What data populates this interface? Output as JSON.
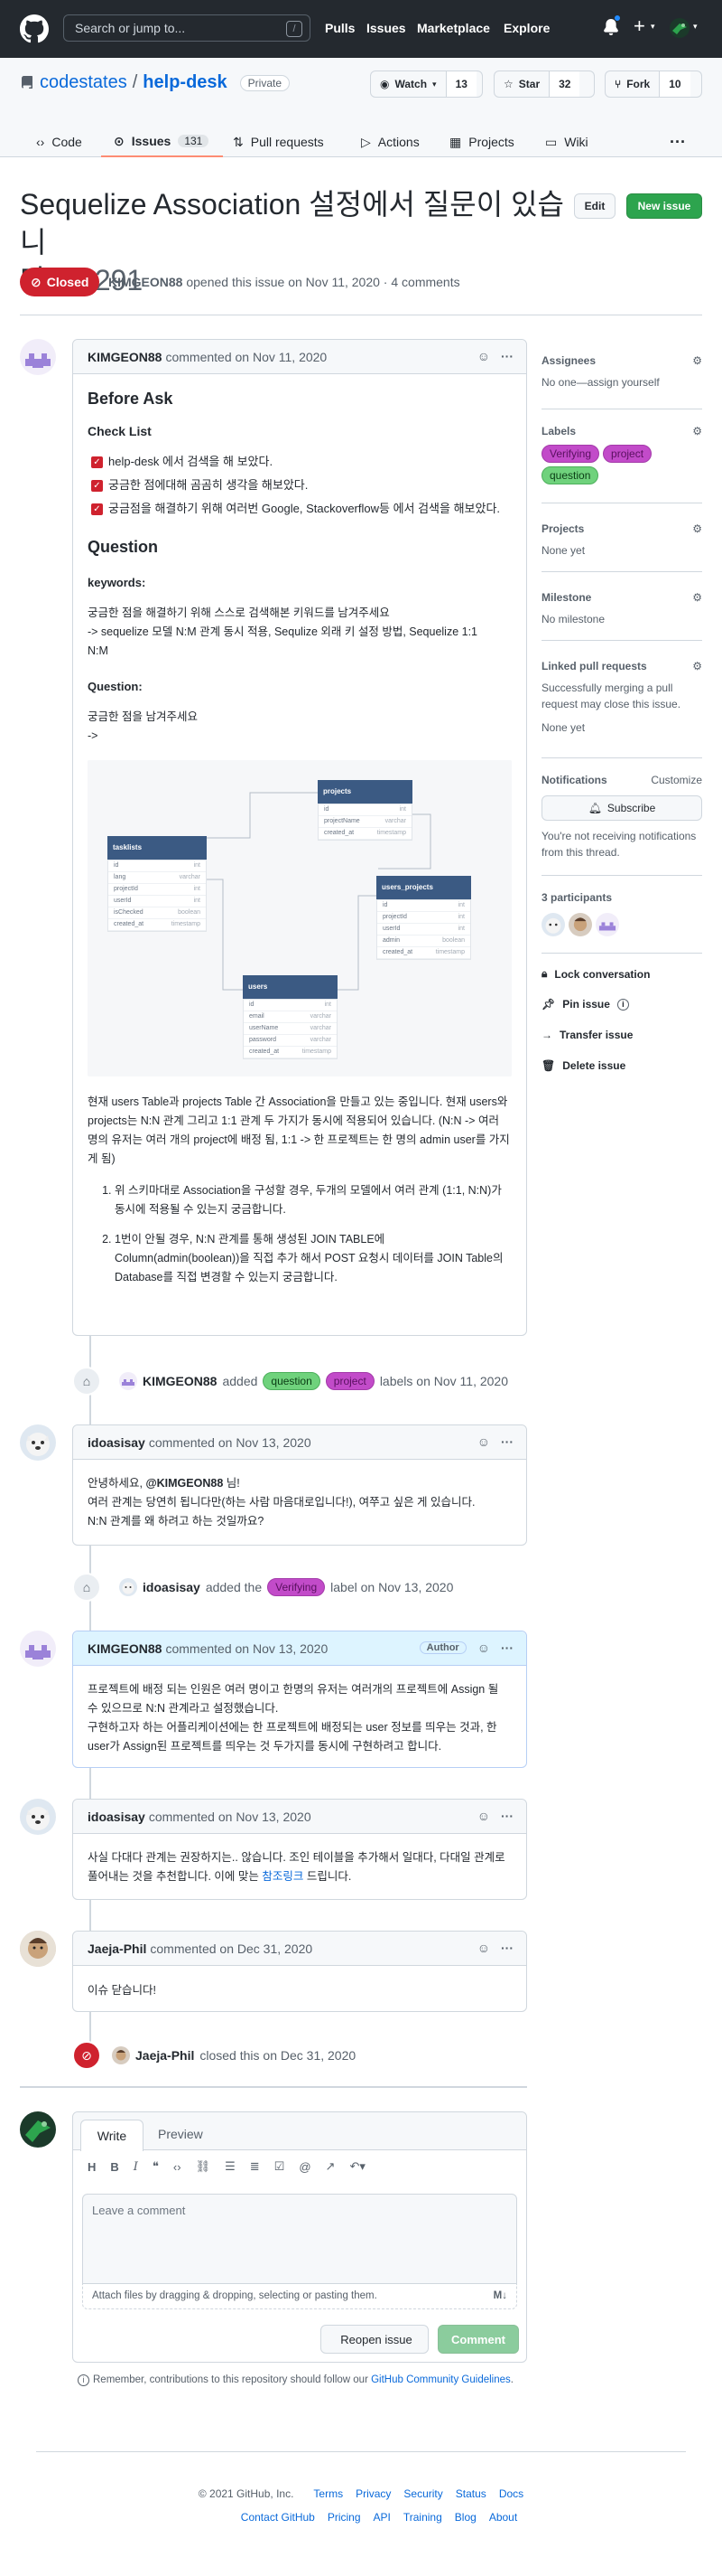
{
  "header": {
    "search_placeholder": "Search or jump to...",
    "search_key": "/",
    "nav": [
      "Pulls",
      "Issues",
      "Marketplace",
      "Explore"
    ]
  },
  "repo": {
    "owner": "codestates",
    "name": "help-desk",
    "visibility": "Private",
    "watch_label": "Watch",
    "watch_count": "13",
    "star_label": "Star",
    "star_count": "32",
    "fork_label": "Fork",
    "fork_count": "10",
    "tabs": [
      {
        "label": "Code"
      },
      {
        "label": "Issues",
        "count": "131"
      },
      {
        "label": "Pull requests"
      },
      {
        "label": "Actions"
      },
      {
        "label": "Projects"
      },
      {
        "label": "Wiki"
      }
    ]
  },
  "issue": {
    "title": "Sequelize Association 설정에서 질문이 있습니다.",
    "title_line1": "Sequelize Association 설정에서 질문이 있습니",
    "title_line2": "다.",
    "number": "#2291",
    "edit_label": "Edit",
    "new_issue_label": "New issue",
    "state": "Closed",
    "author": "KIMGEON88",
    "opened_text": "opened this issue on Nov 11, 2020 · 4 comments"
  },
  "first_comment": {
    "author": "KIMGEON88",
    "action": "commented on Nov 11, 2020",
    "h_before": "Before Ask",
    "checklist_title": "Check List",
    "checklist": [
      "help-desk 에서 검색을 해 보았다.",
      "궁금한 점에대해 곰곰히 생각을 해보았다.",
      "궁금점을 해결하기 위해 여러번 Google, Stackoverflow등 에서 검색을 해보았다."
    ],
    "h_question": "Question",
    "keywords_label": "keywords:",
    "keywords_line1": "궁금한 점을 해결하기 위해 스스로 검색해본 키워드를 남겨주세요",
    "keywords_line2": "-> sequelize 모델 N:M 관계 동시 적용, Sequlize 외래 키 설정 방법, Sequelize 1:1",
    "keywords_line3": "N:M",
    "question_label": "Question:",
    "question_line1": "궁금한 점을 남겨주세요",
    "question_line2": "->",
    "erd": {
      "projects": {
        "title": "projects",
        "rows": [
          [
            "id",
            "int"
          ],
          [
            "projectName",
            "varchar"
          ],
          [
            "created_at",
            "timestamp"
          ]
        ]
      },
      "tasklists": {
        "title": "tasklists",
        "rows": [
          [
            "id",
            "int"
          ],
          [
            "lang",
            "varchar"
          ],
          [
            "projectId",
            "int"
          ],
          [
            "userId",
            "int"
          ],
          [
            "isChecked",
            "boolean"
          ],
          [
            "created_at",
            "timestamp"
          ]
        ]
      },
      "users_projects": {
        "title": "users_projects",
        "rows": [
          [
            "id",
            "int"
          ],
          [
            "projectId",
            "int"
          ],
          [
            "userId",
            "int"
          ],
          [
            "admin",
            "boolean"
          ],
          [
            "created_at",
            "timestamp"
          ]
        ]
      },
      "users": {
        "title": "users",
        "rows": [
          [
            "id",
            "int"
          ],
          [
            "email",
            "varchar"
          ],
          [
            "userName",
            "varchar"
          ],
          [
            "password",
            "varchar"
          ],
          [
            "created_at",
            "timestamp"
          ]
        ]
      }
    },
    "para1": "현재 users Table과 projects Table 간 Association을 만들고 있는 중입니다. 현재 users와 projects는 N:N 관계 그리고 1:1 관계 두 가지가 동시에 적용되어 있습니다. (N:N -> 여러 명의 유저는 여러 개의 project에 배정 됨, 1:1 -> 한 프로젝트는 한 명의 admin user를 가지게 됨)",
    "list": [
      "위 스키마대로 Association을 구성할 경우, 두개의 모델에서 여러 관계 (1:1, N:N)가 동시에 적용될 수 있는지 궁금합니다.",
      "1번이 안될 경우, N:N 관계를 통해 생성된 JOIN TABLE에 Column(admin(boolean))을 직접 추가 해서 POST 요청시 데이터를 JOIN Table의 Database를 직접 변경할 수 있는지 궁금합니다."
    ]
  },
  "event1": {
    "actor": "KIMGEON88",
    "added": "added",
    "labels": [
      "question",
      "project"
    ],
    "rest": "labels on Nov 11, 2020"
  },
  "comment2": {
    "author": "idoasisay",
    "action": "commented on Nov 13, 2020",
    "line1_pre": "안녕하세요, ",
    "mention": "@KIMGEON88",
    "line1_post": " 님!",
    "line2": "여러 관계는 당연히 됩니다만(하는 사람 마음대로입니다!), 여쭈고 싶은 게 있습니다.",
    "line3": "N:N 관계를 왜 하려고 하는 것일까요?"
  },
  "event2": {
    "actor": "idoasisay",
    "added": "added the",
    "label": "Verifying",
    "rest": "label on Nov 13, 2020"
  },
  "comment3": {
    "author": "KIMGEON88",
    "action": "commented on Nov 13, 2020",
    "badge": "Author",
    "line1": "프로젝트에 배정 되는 인원은 여러 명이고 한명의 유저는 여러개의 프로젝트에 Assign 될 수 있으므로 N:N 관계라고 설정했습니다.",
    "line2": "구현하고자 하는 어플리케이션에는 한 프로젝트에 배정되는 user 정보를 띄우는 것과, 한 user가 Assign된 프로젝트를 띄우는 것 두가지를 동시에 구현하려고 합니다."
  },
  "comment4": {
    "author": "idoasisay",
    "action": "commented on Nov 13, 2020",
    "text": "사실 다대다 관계는 권장하지는.. 않습니다. 조인 테이블을 추가해서 일대다, 다대일 관계로 풀어내는 것을 추천합니다. 이에 맞는 ",
    "link": "참조링크",
    "text_after": " 드립니다."
  },
  "comment5": {
    "author": "Jaeja-Phil",
    "action": "commented on Dec 31, 2020",
    "text": "이슈 닫습니다!"
  },
  "event3": {
    "actor": "Jaeja-Phil",
    "rest": "closed this on Dec 31, 2020"
  },
  "editor": {
    "tab_write": "Write",
    "tab_preview": "Preview",
    "placeholder": "Leave a comment",
    "attach": "Attach files by dragging & dropping, selecting or pasting them.",
    "reopen": "Reopen issue",
    "submit": "Comment",
    "notice_pre": "Remember, contributions to this repository should follow our ",
    "notice_link": "GitHub Community Guidelines",
    "notice_post": "."
  },
  "sidebar": {
    "assignees_h": "Assignees",
    "assignees_v": "No one—assign yourself",
    "labels_h": "Labels",
    "labels": [
      {
        "name": "Verifying",
        "color": "#c24bc9"
      },
      {
        "name": "project",
        "color": "#c24bc9"
      },
      {
        "name": "question",
        "color": "#6fd27c"
      }
    ],
    "projects_h": "Projects",
    "projects_v": "None yet",
    "milestone_h": "Milestone",
    "milestone_v": "No milestone",
    "linked_h": "Linked pull requests",
    "linked_v": "Successfully merging a pull request may close this issue.",
    "linked_v2": "None yet",
    "notif_h": "Notifications",
    "notif_customize": "Customize",
    "subscribe": "Subscribe",
    "notif_v": "You're not receiving notifications from this thread.",
    "participants_h": "3 participants",
    "lock": "Lock conversation",
    "pin": "Pin issue",
    "transfer": "Transfer issue",
    "delete": "Delete issue"
  },
  "footer": {
    "copyright": "© 2021 GitHub, Inc.",
    "links1": [
      "Terms",
      "Privacy",
      "Security",
      "Status",
      "Docs"
    ],
    "links2": [
      "Contact GitHub",
      "Pricing",
      "API",
      "Training",
      "Blog",
      "About"
    ]
  }
}
